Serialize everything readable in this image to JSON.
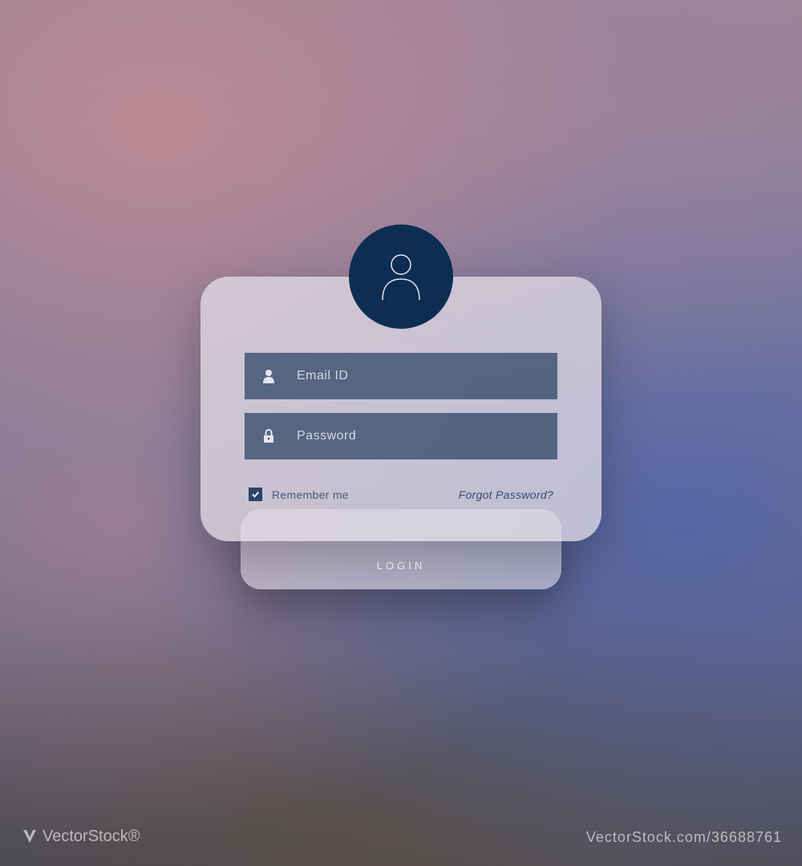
{
  "form": {
    "email_placeholder": "Email ID",
    "password_placeholder": "Password",
    "remember_label": "Remember me",
    "remember_checked": true,
    "forgot_label": "Forgot Password?",
    "login_button": "LOGIN"
  },
  "colors": {
    "avatar_bg": "#0e2d52",
    "input_bg": "#455773",
    "card_bg": "rgba(225,220,230,0.75)"
  },
  "watermark": {
    "brand": "VectorStock®",
    "id": "VectorStock.com/36688761"
  }
}
